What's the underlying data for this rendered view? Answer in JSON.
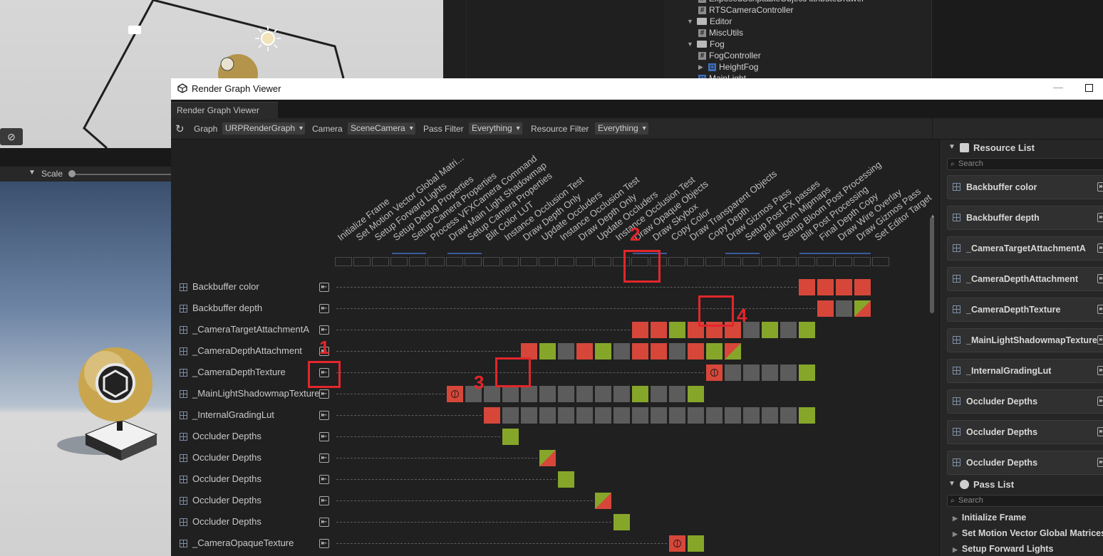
{
  "background": {
    "project_tree": [
      {
        "label": "ExposedScriptableObjectAttributeDrawer",
        "kind": "script",
        "indent": 2
      },
      {
        "label": "RTSCameraController",
        "kind": "script",
        "indent": 2
      },
      {
        "label": "Editor",
        "kind": "folder",
        "indent": 1
      },
      {
        "label": "MiscUtils",
        "kind": "script",
        "indent": 2
      },
      {
        "label": "Fog",
        "kind": "folder",
        "indent": 1
      },
      {
        "label": "FogController",
        "kind": "script",
        "indent": 2
      },
      {
        "label": "HeightFog",
        "kind": "asset",
        "indent": 2
      },
      {
        "label": "MainLight",
        "kind": "asset",
        "indent": 2
      }
    ],
    "scale_label": "Scale"
  },
  "window": {
    "title": "Render Graph Viewer",
    "tab_label": "Render Graph Viewer",
    "toolbar": {
      "graph_label": "Graph",
      "graph_value": "URPRenderGraph",
      "camera_label": "Camera",
      "camera_value": "SceneCamera",
      "pass_filter_label": "Pass Filter",
      "pass_filter_value": "Everything",
      "resource_filter_label": "Resource Filter",
      "resource_filter_value": "Everything"
    }
  },
  "passes": [
    "Initialize Frame",
    "Set Motion Vector Global Matri...",
    "Setup Forward Lights",
    "Setup Debug Properties",
    "Setup Camera Properties",
    "Process VFXCamera Command",
    "Draw Main Light Shadowmap",
    "Setup Camera Properties",
    "Blit Color LUT",
    "Instance Occlusion Test",
    "Draw Depth Only",
    "Update Occluders",
    "Instance Occlusion Test",
    "Draw Depth Only",
    "Update Occluders",
    "Instance Occlusion Test",
    "Draw Opaque Objects",
    "Draw Skybox",
    "Copy Color",
    "Draw Transparent Objects",
    "Copy Depth",
    "Draw Gizmos Pass",
    "Setup Post FX passes",
    "Blit Bloom Mipmaps",
    "Setup Bloom Post Processing",
    "Blit Post Processing",
    "Final Depth Copy",
    "Draw Wire Overlay",
    "Draw Gizmos Pass",
    "Set Editor Target"
  ],
  "resources": [
    {
      "name": "Backbuffer color",
      "cells": [
        [
          25,
          "r"
        ],
        [
          26,
          "r"
        ],
        [
          27,
          "r"
        ],
        [
          28,
          "r"
        ]
      ]
    },
    {
      "name": "Backbuffer depth",
      "cells": [
        [
          26,
          "r"
        ],
        [
          27,
          "n"
        ],
        [
          28,
          "rg"
        ]
      ]
    },
    {
      "name": "_CameraTargetAttachmentA",
      "cells": [
        [
          16,
          "r"
        ],
        [
          17,
          "r"
        ],
        [
          18,
          "g"
        ],
        [
          19,
          "r"
        ],
        [
          20,
          "r"
        ],
        [
          21,
          "r"
        ],
        [
          22,
          "n"
        ],
        [
          23,
          "g"
        ],
        [
          24,
          "n"
        ],
        [
          25,
          "g"
        ]
      ]
    },
    {
      "name": "_CameraDepthAttachment",
      "cells": [
        [
          10,
          "r"
        ],
        [
          11,
          "g"
        ],
        [
          12,
          "n"
        ],
        [
          13,
          "r"
        ],
        [
          14,
          "g"
        ],
        [
          15,
          "n"
        ],
        [
          16,
          "r"
        ],
        [
          17,
          "r"
        ],
        [
          18,
          "n"
        ],
        [
          19,
          "r"
        ],
        [
          20,
          "g"
        ],
        [
          21,
          "rg2"
        ]
      ]
    },
    {
      "name": "_CameraDepthTexture",
      "cells": [
        [
          20,
          "rglobe"
        ],
        [
          21,
          "n"
        ],
        [
          22,
          "n"
        ],
        [
          23,
          "n"
        ],
        [
          24,
          "n"
        ],
        [
          25,
          "g"
        ]
      ]
    },
    {
      "name": "_MainLightShadowmapTexture",
      "cells": [
        [
          6,
          "rglobe"
        ],
        [
          7,
          "n"
        ],
        [
          8,
          "n"
        ],
        [
          9,
          "n"
        ],
        [
          10,
          "n"
        ],
        [
          11,
          "n"
        ],
        [
          12,
          "n"
        ],
        [
          13,
          "n"
        ],
        [
          14,
          "n"
        ],
        [
          15,
          "n"
        ],
        [
          16,
          "g"
        ],
        [
          17,
          "n"
        ],
        [
          18,
          "n"
        ],
        [
          19,
          "g"
        ]
      ]
    },
    {
      "name": "_InternalGradingLut",
      "cells": [
        [
          8,
          "r"
        ],
        [
          9,
          "n"
        ],
        [
          10,
          "n"
        ],
        [
          11,
          "n"
        ],
        [
          12,
          "n"
        ],
        [
          13,
          "n"
        ],
        [
          14,
          "n"
        ],
        [
          15,
          "n"
        ],
        [
          16,
          "n"
        ],
        [
          17,
          "n"
        ],
        [
          18,
          "n"
        ],
        [
          19,
          "n"
        ],
        [
          20,
          "n"
        ],
        [
          21,
          "n"
        ],
        [
          22,
          "n"
        ],
        [
          23,
          "n"
        ],
        [
          24,
          "n"
        ],
        [
          25,
          "g"
        ]
      ]
    },
    {
      "name": "Occluder Depths",
      "cells": [
        [
          9,
          "g"
        ]
      ]
    },
    {
      "name": "Occluder Depths",
      "cells": [
        [
          11,
          "rg"
        ]
      ]
    },
    {
      "name": "Occluder Depths",
      "cells": [
        [
          12,
          "g"
        ]
      ]
    },
    {
      "name": "Occluder Depths",
      "cells": [
        [
          14,
          "rg"
        ]
      ]
    },
    {
      "name": "Occluder Depths",
      "cells": [
        [
          15,
          "g"
        ]
      ]
    },
    {
      "name": "_CameraOpaqueTexture",
      "cells": [
        [
          18,
          "rglobe"
        ],
        [
          19,
          "g"
        ]
      ]
    }
  ],
  "annotations": [
    "1",
    "2",
    "3",
    "4"
  ],
  "resource_list": {
    "title": "Resource List",
    "search_placeholder": "Search",
    "items": [
      "Backbuffer color",
      "Backbuffer depth",
      "_CameraTargetAttachmentA",
      "_CameraDepthAttachment",
      "_CameraDepthTexture",
      "_MainLightShadowmapTexture",
      "_InternalGradingLut",
      "Occluder Depths",
      "Occluder Depths",
      "Occluder Depths"
    ]
  },
  "pass_list": {
    "title": "Pass List",
    "search_placeholder": "Search",
    "items": [
      "Initialize Frame",
      "Set Motion Vector Global Matrices",
      "Setup Forward Lights"
    ]
  },
  "colors": {
    "write": "#d6473a",
    "read": "#86a62a",
    "unused": "#5c5c5c",
    "annotation": "#e3262b"
  }
}
